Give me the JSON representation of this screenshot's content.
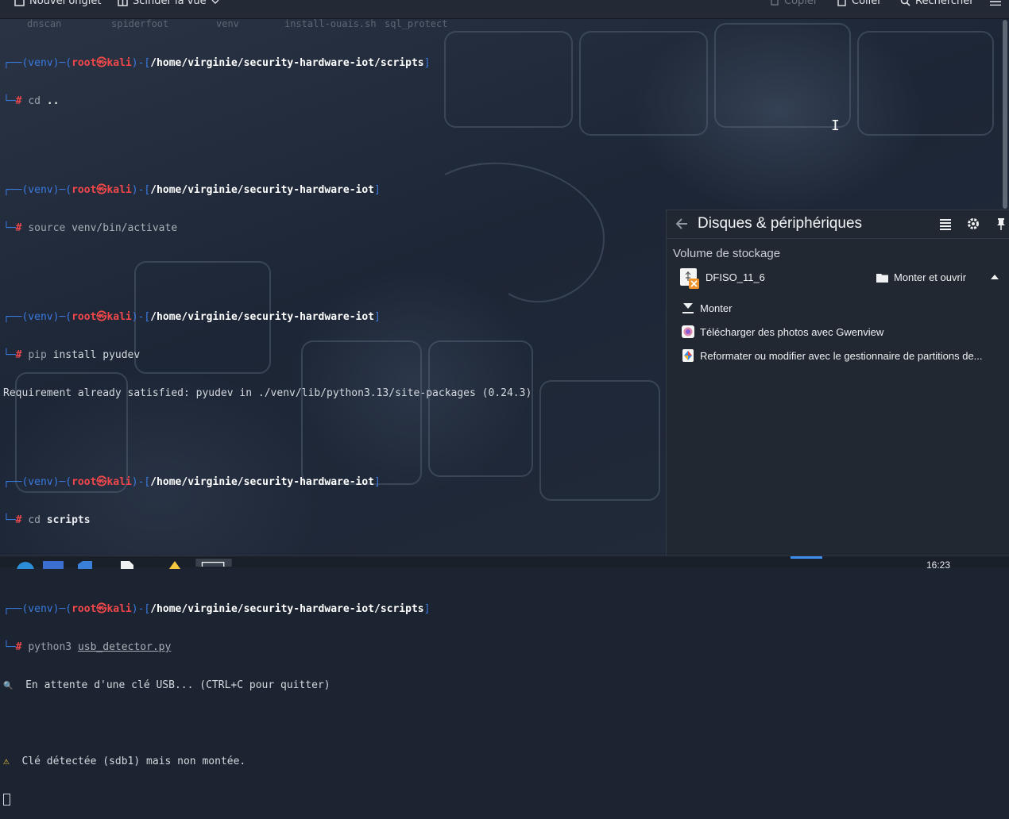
{
  "toolbar": {
    "new_tab": "Nouvel onglet",
    "split_view": "Scinder la vue",
    "copy": "Copier",
    "paste": "Coller",
    "search": "Rechercher"
  },
  "tabs": [
    "dnscan",
    "spiderfoot",
    "venv",
    "install-ouais.sh",
    "sql_protect"
  ],
  "terminal": {
    "venv": "(venv)",
    "user": "root",
    "host": "kali",
    "blocks": [
      {
        "path": "/home/virginie/security-hardware-iot/scripts",
        "cmd": "cd",
        "arg": ".."
      },
      {
        "path": "/home/virginie/security-hardware-iot",
        "cmd": "source",
        "arg": "venv/bin/activate"
      },
      {
        "path": "/home/virginie/security-hardware-iot",
        "cmd": "pip",
        "arg": "install pyudev"
      },
      {
        "path": "/home/virginie/security-hardware-iot",
        "cmd": "cd",
        "arg": "scripts"
      },
      {
        "path": "/home/virginie/security-hardware-iot/scripts",
        "cmd": "python3",
        "arg": "usb_detector.py"
      }
    ],
    "pip_output": "Requirement already satisfied: pyudev in ./venv/lib/python3.13/site-packages (0.24.3)",
    "waiting": "En attente d'une clé USB... (CTRL+C pour quitter)",
    "detected": "Clé détectée (sdb1) mais non montée."
  },
  "popup": {
    "title": "Disques & périphériques",
    "section": "Volume de stockage",
    "device_name": "DFISO_11_6",
    "mount_open": "Monter et ouvrir",
    "actions": [
      "Monter",
      "Télécharger des photos avec Gwenview",
      "Reformater ou modifier avec le gestionnaire de partitions de..."
    ]
  },
  "panel": {
    "clock": "16:23"
  },
  "colors": {
    "prompt_blue": "#3a7ae0",
    "root_red": "#f0484a",
    "popup_bg": "#212832",
    "accent": "#3d8ef0"
  }
}
